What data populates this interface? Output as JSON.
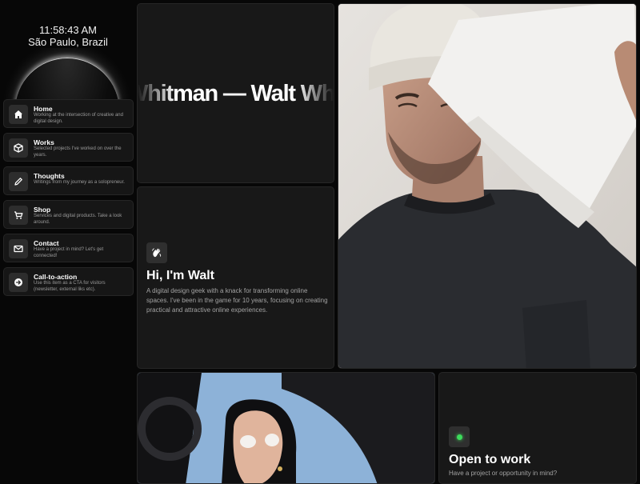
{
  "clock": {
    "time": "11:58:43 AM",
    "location": "São Paulo, Brazil"
  },
  "nav": {
    "items": [
      {
        "title": "Home",
        "desc": "Working at the intersection of creative and digital design.",
        "icon": "home-icon"
      },
      {
        "title": "Works",
        "desc": "Selected projects I've worked on over the years.",
        "icon": "cube-icon"
      },
      {
        "title": "Thoughts",
        "desc": "Writings from my journey as a solopreneur.",
        "icon": "pencil-icon"
      },
      {
        "title": "Shop",
        "desc": "Services and digital products. Take a look around.",
        "icon": "cart-icon"
      },
      {
        "title": "Contact",
        "desc": "Have a project in mind? Let's get connected!",
        "icon": "mail-icon"
      },
      {
        "title": "Call-to-action",
        "desc": "Use this item as a CTA for visitors (newsletter, external liks etc).",
        "icon": "arrow-right-icon"
      }
    ]
  },
  "marquee": {
    "text": "Whitman — Walt Whitman — Walt Whitman"
  },
  "intro": {
    "title": "Hi, I'm Walt",
    "text": "A digital design geek with a knack for transforming online spaces. I've been in the game for 10 years, focusing on creating practical and attractive online experiences.",
    "icon": "waving-hand-icon"
  },
  "open_to_work": {
    "title": "Open to work",
    "text": "Have a project or opportunity in mind?",
    "status_color": "#3ddc5b"
  },
  "colors": {
    "background": "#070707",
    "card": "#181818",
    "border": "#262626",
    "muted_text": "#a3a3a3"
  }
}
